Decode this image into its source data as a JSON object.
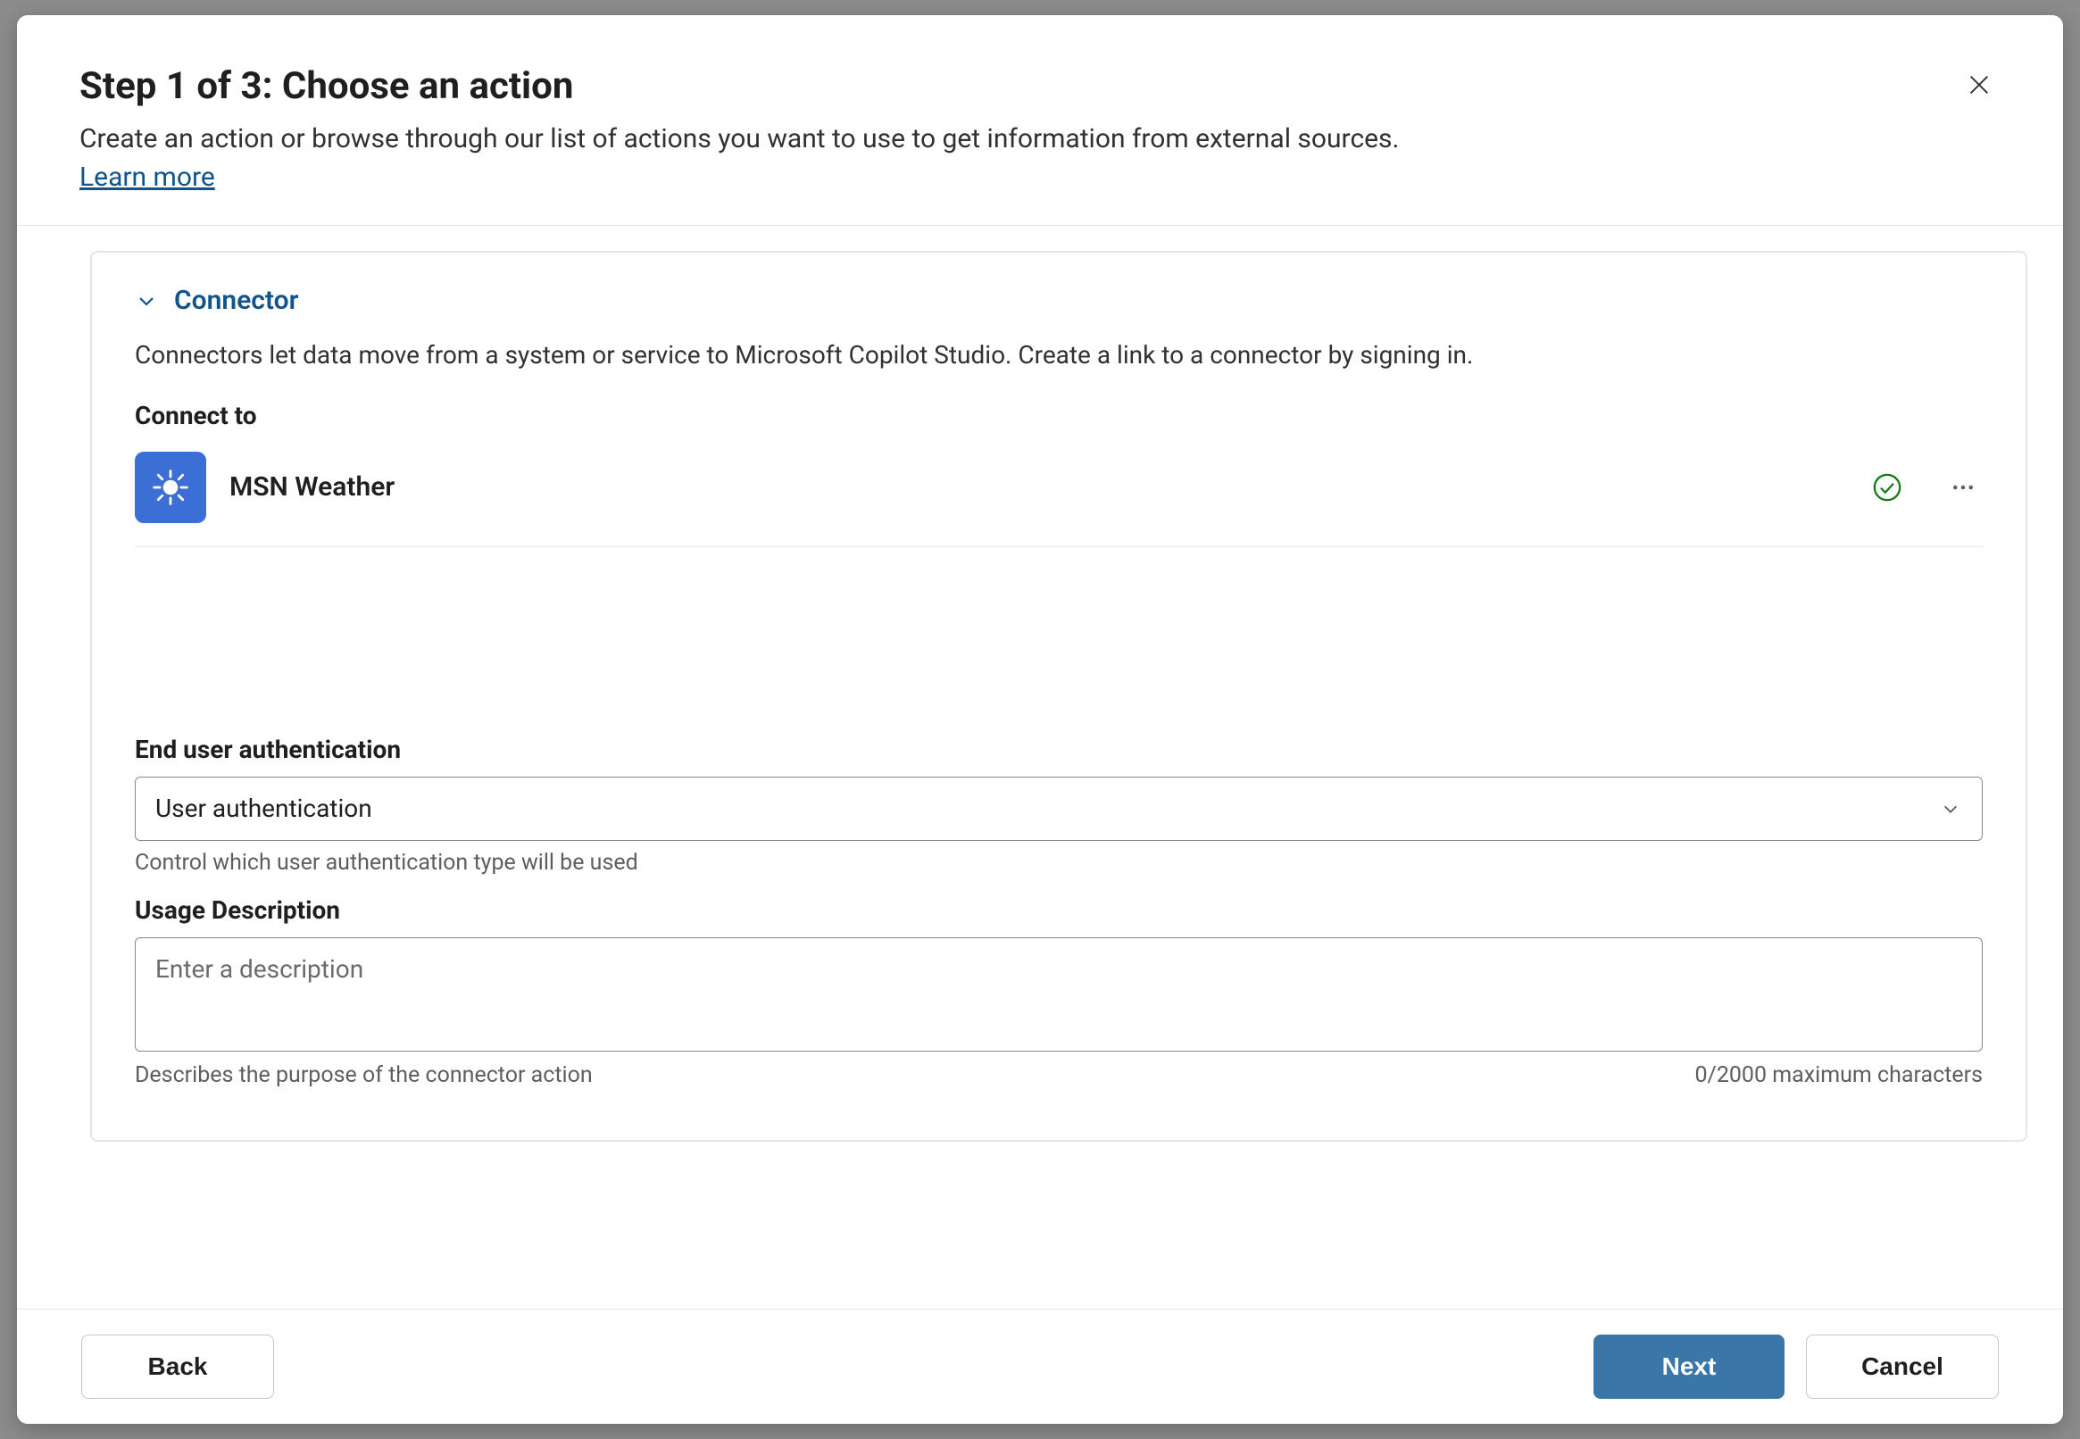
{
  "header": {
    "title": "Step 1 of 3: Choose an action",
    "subtitle": "Create an action or browse through our list of actions you want to use to get information from external sources.",
    "learn_more": "Learn more"
  },
  "connector": {
    "section_title": "Connector",
    "description": "Connectors let data move from a system or service to Microsoft Copilot Studio. Create a link to a connector by signing in.",
    "connect_to_label": "Connect to",
    "selected_name": "MSN Weather"
  },
  "auth": {
    "label": "End user authentication",
    "selected": "User authentication",
    "helper": "Control which user authentication type will be used"
  },
  "usage": {
    "label": "Usage Description",
    "placeholder": "Enter a description",
    "helper": "Describes the purpose of the connector action",
    "counter": "0/2000 maximum characters"
  },
  "footer": {
    "back": "Back",
    "next": "Next",
    "cancel": "Cancel"
  }
}
